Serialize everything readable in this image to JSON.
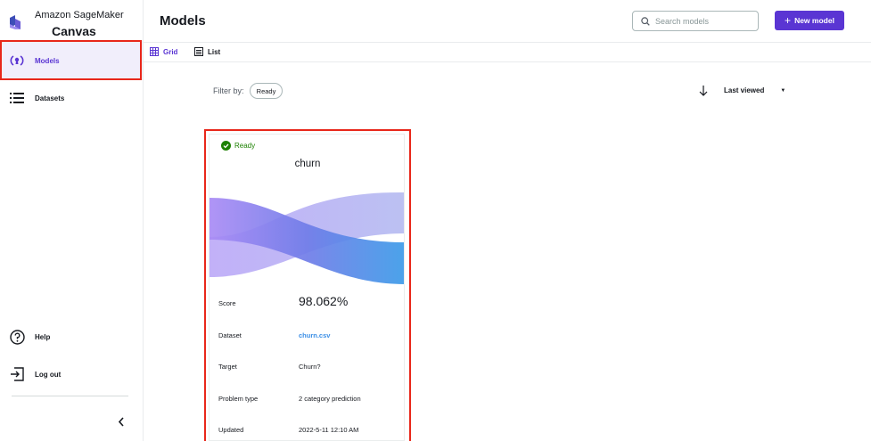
{
  "brand": {
    "line1": "Amazon SageMaker",
    "line2": "Canvas"
  },
  "sidebar": {
    "items": [
      {
        "label": "Models",
        "icon": "models-icon",
        "active": true
      },
      {
        "label": "Datasets",
        "icon": "datasets-icon",
        "active": false
      }
    ],
    "footer": [
      {
        "label": "Help",
        "icon": "help-icon"
      },
      {
        "label": "Log out",
        "icon": "logout-icon"
      }
    ]
  },
  "header": {
    "title": "Models",
    "search_placeholder": "Search models",
    "new_model_label": "New model"
  },
  "view": {
    "grid_label": "Grid",
    "list_label": "List",
    "active": "Grid"
  },
  "filter": {
    "label": "Filter by:",
    "chip": "Ready"
  },
  "sort": {
    "label": "Last viewed"
  },
  "colors": {
    "accent": "#5a35d3",
    "ready": "#1d8102",
    "link": "#3a8ee6",
    "highlight": "#e8271a"
  },
  "card": {
    "status": "Ready",
    "title": "churn",
    "rows": [
      {
        "key": "Score",
        "value": "98.062%"
      },
      {
        "key": "Dataset",
        "value": "churn.csv"
      },
      {
        "key": "Target",
        "value": "Churn?"
      },
      {
        "key": "Problem type",
        "value": "2 category prediction"
      },
      {
        "key": "Updated",
        "value": "2022-5-11 12:10 AM"
      }
    ]
  }
}
